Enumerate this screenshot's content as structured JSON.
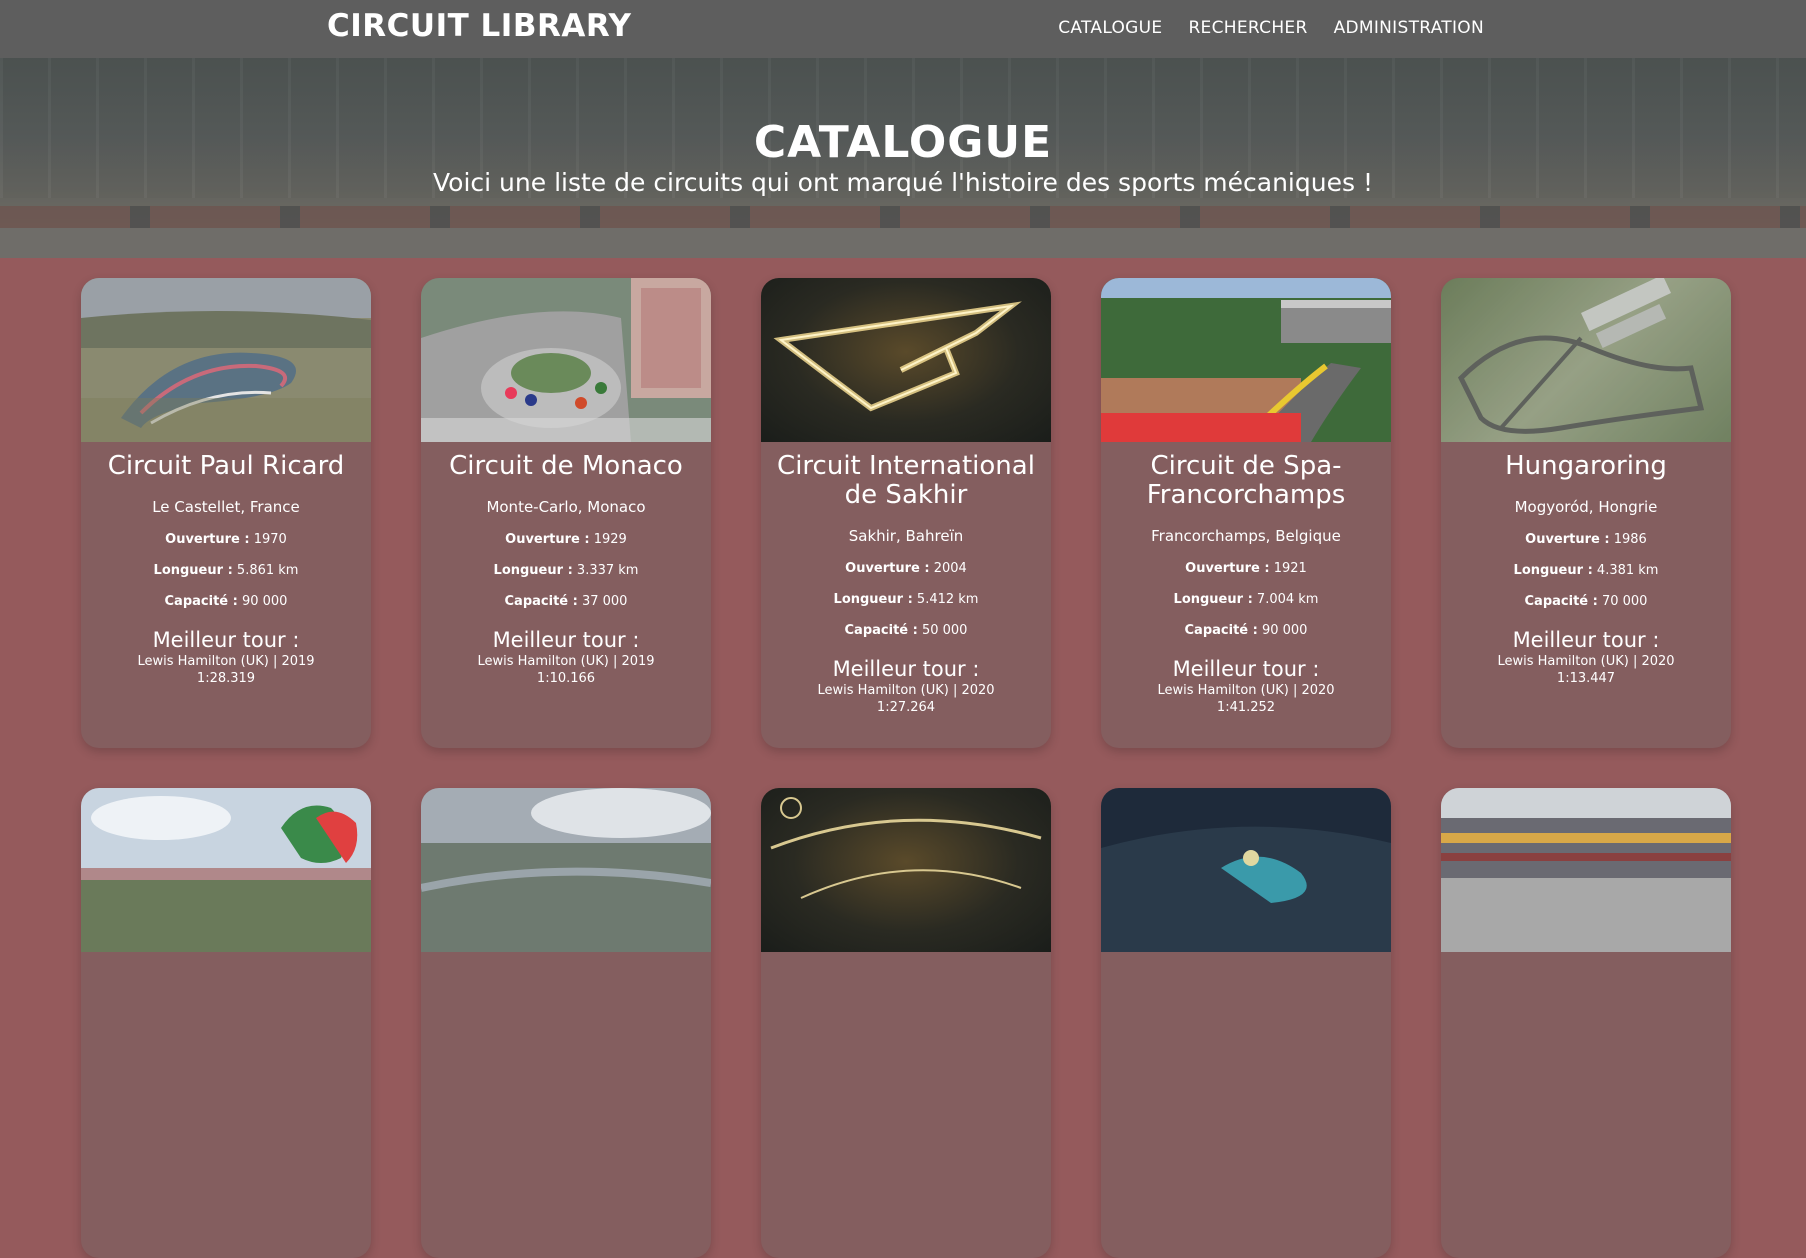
{
  "brand": "CIRCUIT LIBRARY",
  "nav": [
    "CATALOGUE",
    "RECHERCHER",
    "ADMINISTRATION"
  ],
  "hero": {
    "title": "CATALOGUE",
    "subtitle": "Voici une liste de circuits qui ont marqué l'histoire des sports mécaniques !"
  },
  "labels": {
    "opening": "Ouverture :",
    "length": "Longueur :",
    "capacity": "Capacité :",
    "best_lap": "Meilleur tour :"
  },
  "circuits": [
    {
      "name": "Circuit Paul Ricard",
      "location": "Le Castellet, France",
      "opening": "1970",
      "length": "5.861 km",
      "capacity": "90 000",
      "best_lap_driver": "Lewis Hamilton (UK) | 2019",
      "best_lap_time": "1:28.319"
    },
    {
      "name": "Circuit de Monaco",
      "location": "Monte-Carlo, Monaco",
      "opening": "1929",
      "length": "3.337 km",
      "capacity": "37 000",
      "best_lap_driver": "Lewis Hamilton (UK) | 2019",
      "best_lap_time": "1:10.166"
    },
    {
      "name": "Circuit International de Sakhir",
      "location": "Sakhir, Bahreïn",
      "opening": "2004",
      "length": "5.412 km",
      "capacity": "50 000",
      "best_lap_driver": "Lewis Hamilton (UK) | 2020",
      "best_lap_time": "1:27.264"
    },
    {
      "name": "Circuit de Spa-Francorchamps",
      "location": "Francorchamps, Belgique",
      "opening": "1921",
      "length": "7.004 km",
      "capacity": "90 000",
      "best_lap_driver": "Lewis Hamilton (UK) | 2020",
      "best_lap_time": "1:41.252"
    },
    {
      "name": "Hungaroring",
      "location": "Mogyoród, Hongrie",
      "opening": "1986",
      "length": "4.381 km",
      "capacity": "70 000",
      "best_lap_driver": "Lewis Hamilton (UK) | 2020",
      "best_lap_time": "1:13.447"
    }
  ]
}
